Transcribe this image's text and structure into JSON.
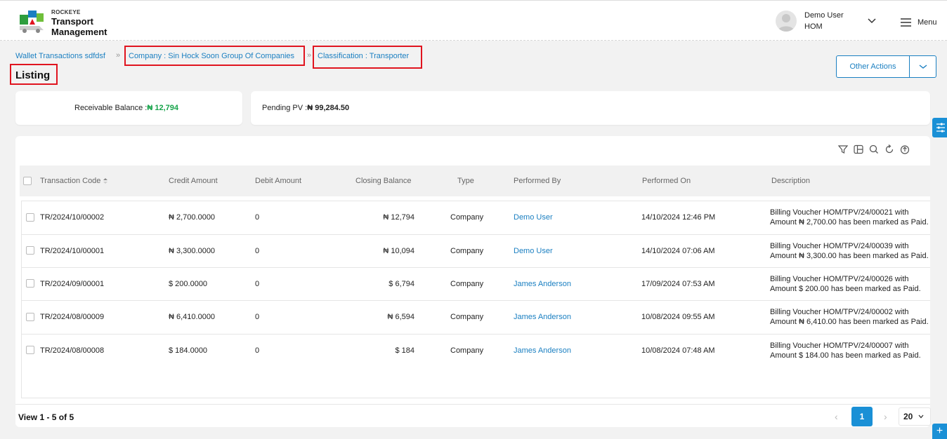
{
  "brand": {
    "small": "ROCKEYE",
    "line1": "Transport",
    "line2": "Management"
  },
  "user": {
    "name": "Demo User",
    "role": "HOM"
  },
  "menu_label": "Menu",
  "breadcrumb": {
    "root": "Wallet Transactions sdfdsf",
    "company": "Company : Sin Hock Soon Group Of Companies",
    "classification": "Classification : Transporter"
  },
  "page_title": "Listing",
  "other_actions": "Other Actions",
  "balances": {
    "receivable_label": "Receivable Balance : ",
    "receivable_value": "₦ 12,794",
    "pending_label": "Pending PV : ",
    "pending_value": "₦ 99,284.50"
  },
  "columns": [
    "Transaction Code",
    "Credit Amount",
    "Debit Amount",
    "Closing Balance",
    "Type",
    "Performed By",
    "Performed On",
    "Description"
  ],
  "rows": [
    {
      "code": "TR/2024/10/00002",
      "credit": "₦ 2,700.0000",
      "debit": "0",
      "closing": "₦ 12,794",
      "type": "Company",
      "by": "Demo User",
      "on": "14/10/2024 12:46 PM",
      "desc1": "Billing Voucher HOM/TPV/24/00021 with",
      "desc2": "Amount ₦ 2,700.00 has been marked as Paid."
    },
    {
      "code": "TR/2024/10/00001",
      "credit": "₦ 3,300.0000",
      "debit": "0",
      "closing": "₦ 10,094",
      "type": "Company",
      "by": "Demo User",
      "on": "14/10/2024 07:06 AM",
      "desc1": "Billing Voucher HOM/TPV/24/00039 with",
      "desc2": "Amount ₦ 3,300.00 has been marked as Paid."
    },
    {
      "code": "TR/2024/09/00001",
      "credit": "$ 200.0000",
      "debit": "0",
      "closing": "$ 6,794",
      "type": "Company",
      "by": "James Anderson",
      "on": "17/09/2024 07:53 AM",
      "desc1": "Billing Voucher HOM/TPV/24/00026 with",
      "desc2": "Amount $ 200.00 has been marked as Paid."
    },
    {
      "code": "TR/2024/08/00009",
      "credit": "₦ 6,410.0000",
      "debit": "0",
      "closing": "₦ 6,594",
      "type": "Company",
      "by": "James Anderson",
      "on": "10/08/2024 09:55 AM",
      "desc1": "Billing Voucher HOM/TPV/24/00002 with",
      "desc2": "Amount ₦ 6,410.00 has been marked as Paid."
    },
    {
      "code": "TR/2024/08/00008",
      "credit": "$ 184.0000",
      "debit": "0",
      "closing": "$ 184",
      "type": "Company",
      "by": "James Anderson",
      "on": "10/08/2024 07:48 AM",
      "desc1": "Billing Voucher HOM/TPV/24/00007 with",
      "desc2": "Amount $ 184.00 has been marked as Paid."
    }
  ],
  "footer": {
    "view_count": "View 1 - 5 of 5",
    "current_page": "1",
    "page_size": "20"
  },
  "icons": [
    "filter-icon",
    "columns-icon",
    "search-icon",
    "refresh-icon",
    "export-icon",
    "settings-sliders-icon",
    "plus-icon"
  ],
  "colors": {
    "accent": "#1a90d6",
    "link": "#1a7fc1",
    "highlight_box": "#e0141f",
    "positive": "#16a34a"
  }
}
